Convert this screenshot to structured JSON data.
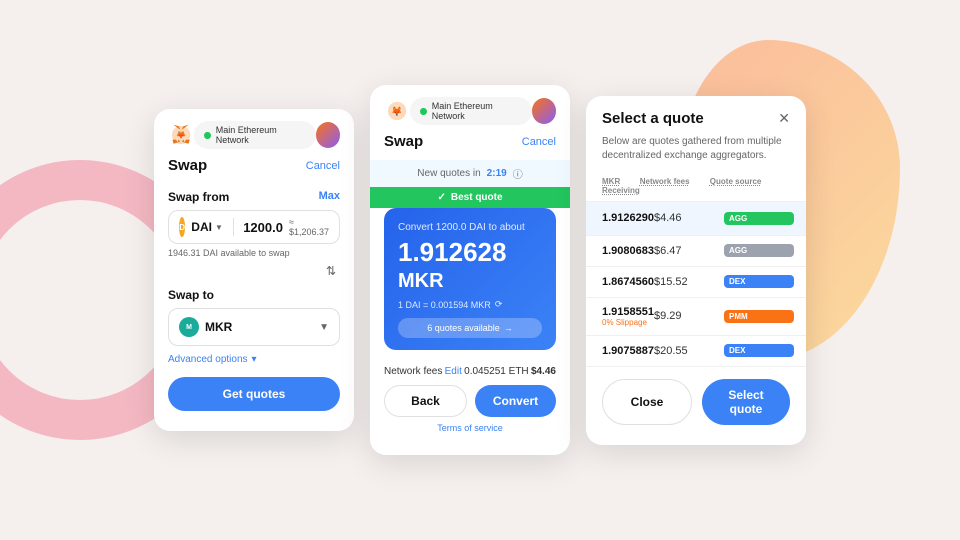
{
  "background": {
    "circle_color": "#f4a0b0",
    "triangle_color": "#ffd580",
    "orange_color": "#ff9966"
  },
  "card1": {
    "network_label": "Main Ethereum Network",
    "title": "Swap",
    "cancel": "Cancel",
    "swap_from_label": "Swap from",
    "max_label": "Max",
    "token_from": "DAI",
    "amount": "1200.0",
    "amount_usd": "≈ $1,206.37",
    "available_text": "1946.31 DAI available to swap",
    "swap_to_label": "Swap to",
    "token_to": "MKR",
    "advanced_label": "Advanced options",
    "get_quotes_label": "Get quotes"
  },
  "card2": {
    "network_label": "Main Ethereum Network",
    "title": "Swap",
    "cancel": "Cancel",
    "new_quotes_prefix": "New quotes in",
    "countdown": "2:19",
    "best_quote_label": "Best quote",
    "convert_text": "Convert 1200.0 DAI to about",
    "receive_amount": "1.912628",
    "receive_token": "MKR",
    "rate_text": "1 DAI = 0.001594 MKR",
    "quotes_available": "6 quotes available",
    "network_fees_label": "Network fees",
    "edit_label": "Edit",
    "fees_eth": "0.045251 ETH",
    "fees_usd": "$4.46",
    "back_label": "Back",
    "convert_label": "Convert",
    "terms_label": "Terms of service"
  },
  "card3": {
    "title": "Select a quote",
    "subtitle": "Below are quotes gathered from multiple decentralized exchange aggregators.",
    "col_receiving": "MKR Receiving",
    "col_fees": "Network fees",
    "col_source": "Quote source",
    "quotes": [
      {
        "amount": "1.9126290",
        "fee": "$4.46",
        "source": "AGG",
        "source_type": "agg_green",
        "selected": true
      },
      {
        "amount": "1.9080683",
        "fee": "$6.47",
        "source": "AGG",
        "source_type": "agg_gray",
        "selected": false
      },
      {
        "amount": "1.8674560",
        "fee": "$15.52",
        "source": "DEX",
        "source_type": "dex",
        "selected": false
      },
      {
        "amount": "1.9158551",
        "fee": "$9.29",
        "source": "PMM",
        "source_type": "pmm",
        "slippage": "0% Slippage",
        "selected": false
      },
      {
        "amount": "1.9075887",
        "fee": "$20.55",
        "source": "DEX",
        "source_type": "dex",
        "selected": false
      }
    ],
    "close_label": "Close",
    "select_quote_label": "Select quote"
  }
}
